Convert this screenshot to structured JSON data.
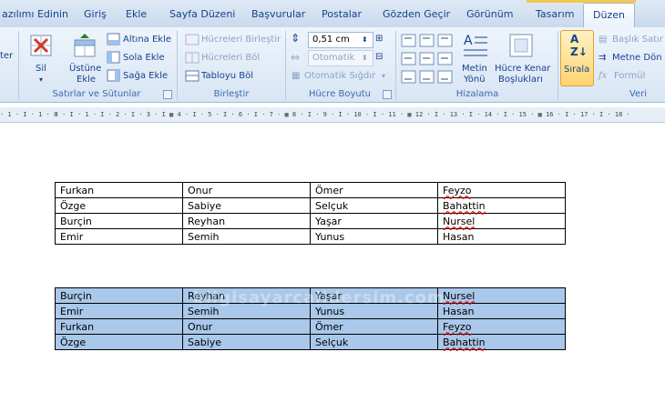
{
  "tabs": [
    {
      "label": "azılımı Edinin",
      "active": false
    },
    {
      "label": "Giriş",
      "active": false
    },
    {
      "label": "Ekle",
      "active": false
    },
    {
      "label": "Sayfa Düzeni",
      "active": false
    },
    {
      "label": "Başvurular",
      "active": false
    },
    {
      "label": "Postalar",
      "active": false
    },
    {
      "label": "Gözden Geçir",
      "active": false
    },
    {
      "label": "Görünüm",
      "active": false
    },
    {
      "label": "Tasarım",
      "active": false
    },
    {
      "label": "Düzen",
      "active": true
    }
  ],
  "ribbon": {
    "left_partial": "ter",
    "sil": "Sil",
    "ustune_ekle_1": "Üstüne",
    "ustune_ekle_2": "Ekle",
    "altina_ekle": "Altına Ekle",
    "sola_ekle": "Sola Ekle",
    "saga_ekle": "Sağa Ekle",
    "group_rows_cols": "Satırlar ve Sütunlar",
    "hucreleri_birlestir": "Hücreleri Birleştir",
    "hucreleri_bol": "Hücreleri Böl",
    "tabloyu_bol": "Tabloyu Böl",
    "group_merge": "Birleştir",
    "height_value": "0,51 cm",
    "width_value": "Otomatik",
    "otomatik_sigdir": "Otomatik Sığdır",
    "group_cell_size": "Hücre Boyutu",
    "metin_yonu_1": "Metin",
    "metin_yonu_2": "Yönü",
    "hucre_kenar_1": "Hücre Kenar",
    "hucre_kenar_2": "Boşlukları",
    "group_alignment": "Hizalama",
    "sirala": "Sırala",
    "baslik_satiri": "Başlık Satır",
    "metne_donustur": "Metne Dön",
    "formul": "Formül",
    "group_data": "Veri"
  },
  "ruler_text": "·  1 · I · 1 · Ⅲ · I · 1 · I · 2 · I · 3 · I ▦ 4 · I · 5 · I · 6 · I · 7 · ▦ 8 · I · 9 · I · 10 · I · 11 · ▦ 12 · I · 13 · I · 14 · I · 15 · ▦ 16 · I · 17 · I · 18 ·",
  "table1": [
    [
      "Furkan",
      "Onur",
      "Ömer",
      "Feyzo"
    ],
    [
      "Özge",
      "Sabiye",
      "Selçuk",
      "Bahattin"
    ],
    [
      "Burçin",
      "Reyhan",
      "Yaşar",
      "Nursel"
    ],
    [
      "Emir",
      "Semih",
      "Yunus",
      "Hasan"
    ]
  ],
  "table2": [
    [
      "Burçin",
      "Reyhan",
      "Yaşar",
      "Nursel"
    ],
    [
      "Emir",
      "Semih",
      "Yunus",
      "Hasan"
    ],
    [
      "Furkan",
      "Onur",
      "Ömer",
      "Feyzo"
    ],
    [
      "Özge",
      "Sabiye",
      "Selçuk",
      "Bahattin"
    ]
  ],
  "watermark": "bilgisayarcalidersim.com",
  "colors": {
    "selection": "#a9c8ea",
    "ribbon_text": "#15428b",
    "group_label": "#3e6aaa"
  }
}
